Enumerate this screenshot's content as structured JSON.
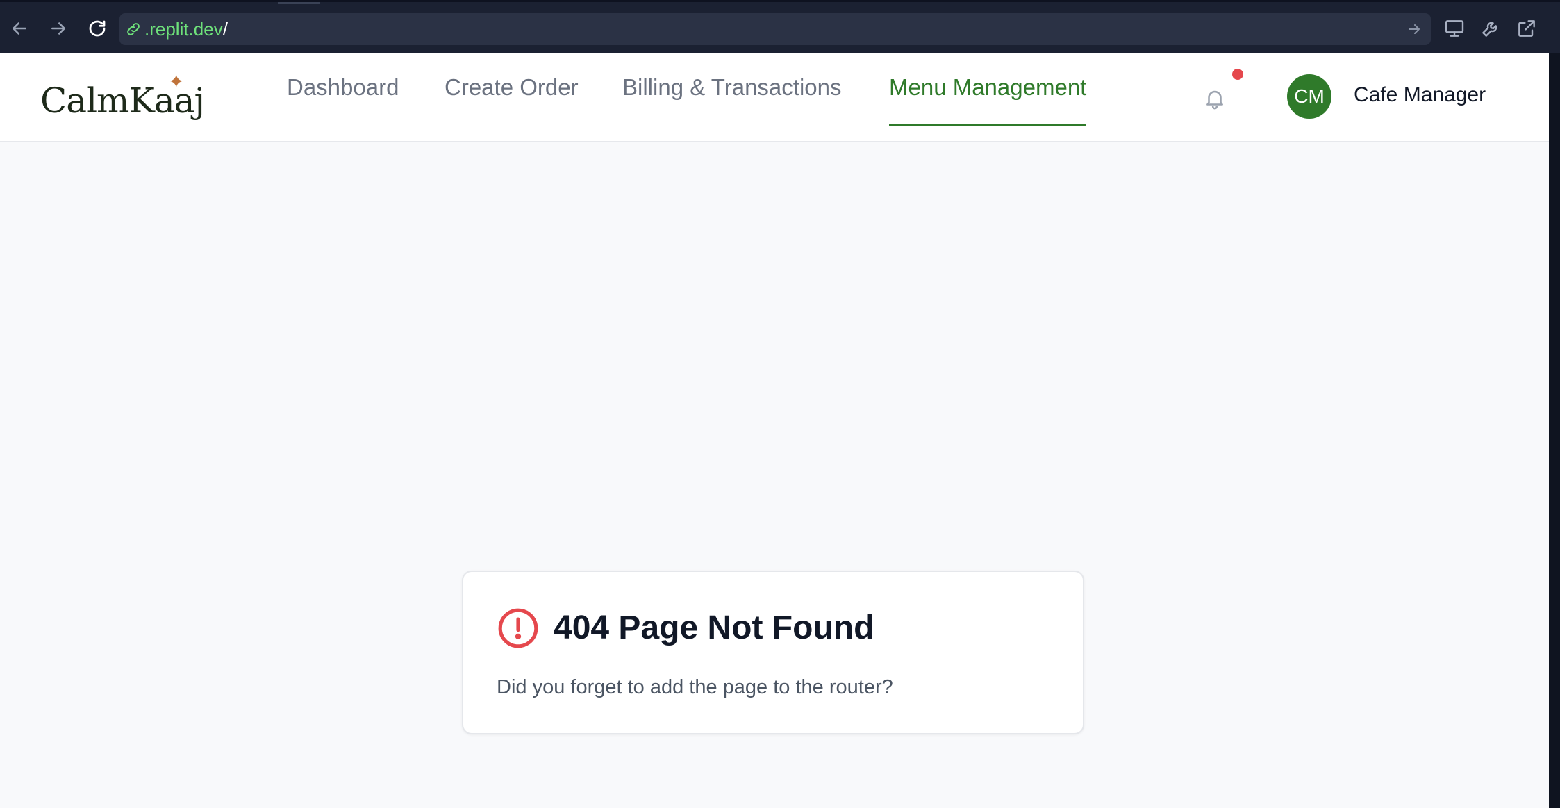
{
  "browser": {
    "url_domain": ".replit.dev",
    "url_path": "/"
  },
  "app": {
    "logo": "CalmKaaj",
    "nav": [
      {
        "label": "Dashboard"
      },
      {
        "label": "Create Order"
      },
      {
        "label": "Billing & Transactions"
      },
      {
        "label": "Menu Management",
        "active": true
      }
    ],
    "user": {
      "initials": "CM",
      "name": "Cafe Manager"
    }
  },
  "error_card": {
    "title": "404 Page Not Found",
    "message": "Did you forget to add the page to the router?"
  },
  "colors": {
    "accent": "#2f7a2a",
    "error": "#e5484d",
    "brand_star": "#c0733a"
  }
}
